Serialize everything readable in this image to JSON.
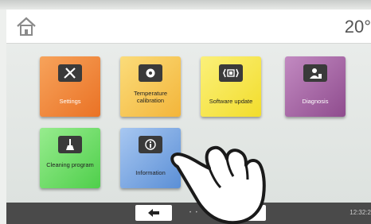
{
  "header": {
    "temperature": "20°"
  },
  "tiles": [
    {
      "label": "Settings",
      "icon": "tools-icon"
    },
    {
      "label": "Temperature calibration",
      "icon": "calibration-icon"
    },
    {
      "label": "Software update",
      "icon": "software-update-icon"
    },
    {
      "label": "Diagnosis",
      "icon": "diagnosis-icon"
    },
    {
      "label": "Cleaning program",
      "icon": "cleaning-icon"
    },
    {
      "label": "Information",
      "icon": "info-icon"
    }
  ],
  "footer": {
    "clock": "12:32:2"
  },
  "colors": {
    "settings": "#ea7225",
    "temperature_calibration": "#f3b53a",
    "software_update": "#f2dd2c",
    "diagnosis": "#8f4c8e",
    "cleaning": "#4fcf4b",
    "information": "#5b8fd6"
  }
}
